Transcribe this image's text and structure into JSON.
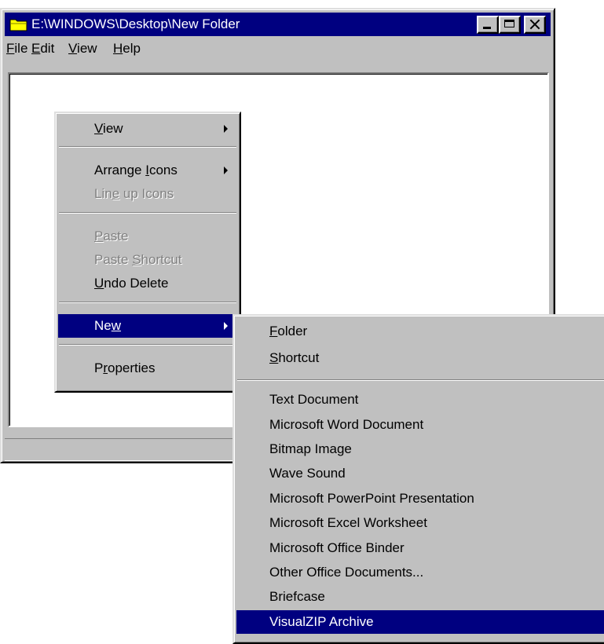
{
  "window": {
    "title": "E:\\WINDOWS\\Desktop\\New Folder",
    "menubar": [
      {
        "before": "",
        "key": "F",
        "after": "ile"
      },
      {
        "before": "",
        "key": "E",
        "after": "dit"
      },
      {
        "before": "",
        "key": "V",
        "after": "iew"
      },
      {
        "before": "",
        "key": "H",
        "after": "elp"
      }
    ]
  },
  "context_menu": {
    "items": [
      {
        "before": "",
        "key": "V",
        "after": "iew",
        "disabled": false,
        "submenu": true
      },
      {
        "before": "Arrange ",
        "key": "I",
        "after": "cons",
        "disabled": false,
        "submenu": true
      },
      {
        "before": "Lin",
        "key": "e",
        "after": " up Icons",
        "disabled": true,
        "submenu": false
      },
      {
        "before": "",
        "key": "P",
        "after": "aste",
        "disabled": true,
        "submenu": false
      },
      {
        "before": "Paste ",
        "key": "S",
        "after": "hortcut",
        "disabled": true,
        "submenu": false
      },
      {
        "before": "",
        "key": "U",
        "after": "ndo Delete",
        "disabled": false,
        "submenu": false
      },
      {
        "before": "Ne",
        "key": "w",
        "after": "",
        "disabled": false,
        "submenu": true,
        "selected": true
      },
      {
        "before": "P",
        "key": "r",
        "after": "operties",
        "disabled": false,
        "submenu": false
      }
    ]
  },
  "new_submenu": {
    "items": [
      {
        "before": "",
        "key": "F",
        "after": "older"
      },
      {
        "before": "",
        "key": "S",
        "after": "hortcut"
      },
      {
        "before": "Text Document",
        "key": "",
        "after": ""
      },
      {
        "before": "Microsoft Word Document",
        "key": "",
        "after": ""
      },
      {
        "before": "Bitmap Image",
        "key": "",
        "after": ""
      },
      {
        "before": "Wave Sound",
        "key": "",
        "after": ""
      },
      {
        "before": "Microsoft PowerPoint Presentation",
        "key": "",
        "after": ""
      },
      {
        "before": "Microsoft Excel Worksheet",
        "key": "",
        "after": ""
      },
      {
        "before": "Microsoft Office Binder",
        "key": "",
        "after": ""
      },
      {
        "before": "Other Office Documents...",
        "key": "",
        "after": ""
      },
      {
        "before": "Briefcase",
        "key": "",
        "after": ""
      },
      {
        "before": "VisualZIP Archive",
        "key": "",
        "after": "",
        "selected": true
      }
    ]
  },
  "colors": {
    "title_bar": "#000080",
    "selection": "#000080",
    "face": "#c0c0c0"
  }
}
